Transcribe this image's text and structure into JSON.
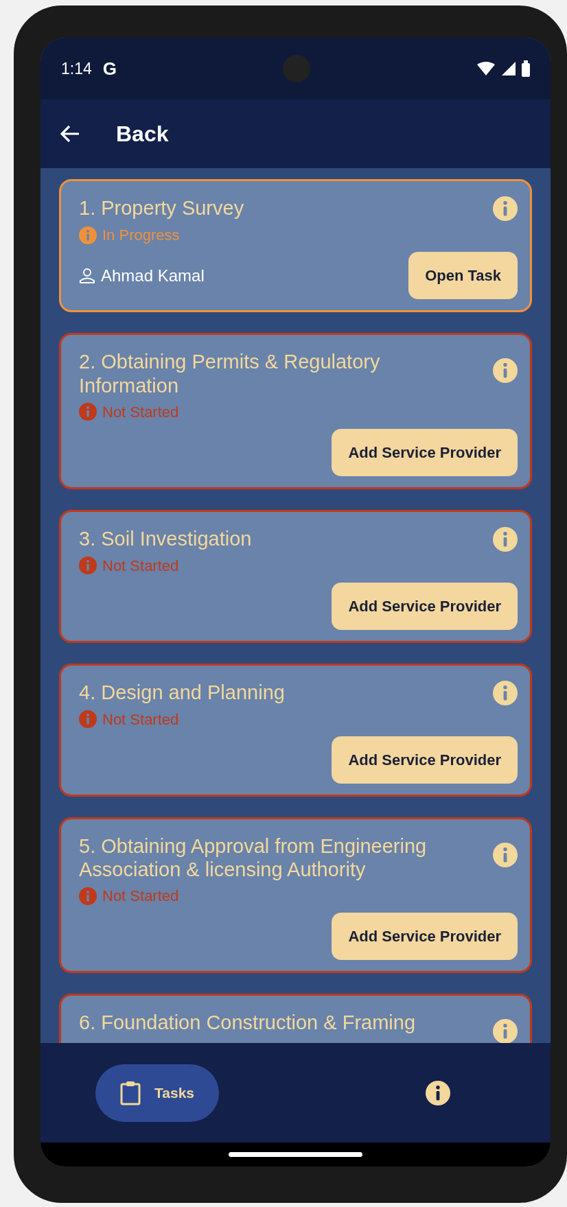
{
  "status_bar": {
    "time": "1:14",
    "app_letter": "G"
  },
  "app_bar": {
    "title": "Back"
  },
  "tasks": [
    {
      "title": "1. Property Survey",
      "status": {
        "kind": "in_progress",
        "label": "In Progress"
      },
      "assignee": "Ahmad Kamal",
      "button": "Open Task"
    },
    {
      "title": "2. Obtaining Permits & Regulatory Information",
      "status": {
        "kind": "not_started",
        "label": "Not Started"
      },
      "button": "Add Service Provider"
    },
    {
      "title": "3. Soil Investigation",
      "status": {
        "kind": "not_started",
        "label": "Not Started"
      },
      "button": "Add Service Provider"
    },
    {
      "title": "4. Design and Planning",
      "status": {
        "kind": "not_started",
        "label": "Not Started"
      },
      "button": "Add Service Provider"
    },
    {
      "title": "5. Obtaining Approval from Engineering Association & licensing Authority",
      "status": {
        "kind": "not_started",
        "label": "Not Started"
      },
      "button": "Add Service Provider"
    },
    {
      "title": "6. Foundation Construction & Framing",
      "color": "#c0391b"
    }
  ],
  "bottom_nav": [
    {
      "label": "Tasks",
      "selected": true
    },
    {
      "kind": "info",
      "selected": false
    }
  ]
}
